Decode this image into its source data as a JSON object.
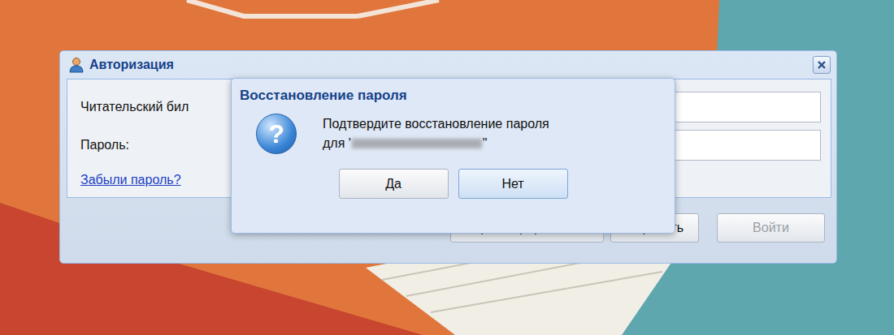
{
  "auth_window": {
    "title": "Авторизация",
    "fields": [
      {
        "label": "Читательский бил"
      },
      {
        "label": "Пароль:"
      }
    ],
    "link": "Забыли пароль?",
    "buttons": [
      {
        "label": "Зарегистрироваться",
        "disabled": false
      },
      {
        "label": "Сбросить",
        "disabled": false
      },
      {
        "label": "Войти",
        "disabled": true
      }
    ]
  },
  "dialog": {
    "title": "Восстановление пароля",
    "icon_glyph": "?",
    "message": "Подтвердите восстановление пароля",
    "prefix": "для '",
    "blurred": true,
    "suffix": "\"",
    "buttons": [
      {
        "label": "Да",
        "focused": false
      },
      {
        "label": "Нет",
        "focused": true
      }
    ]
  }
}
